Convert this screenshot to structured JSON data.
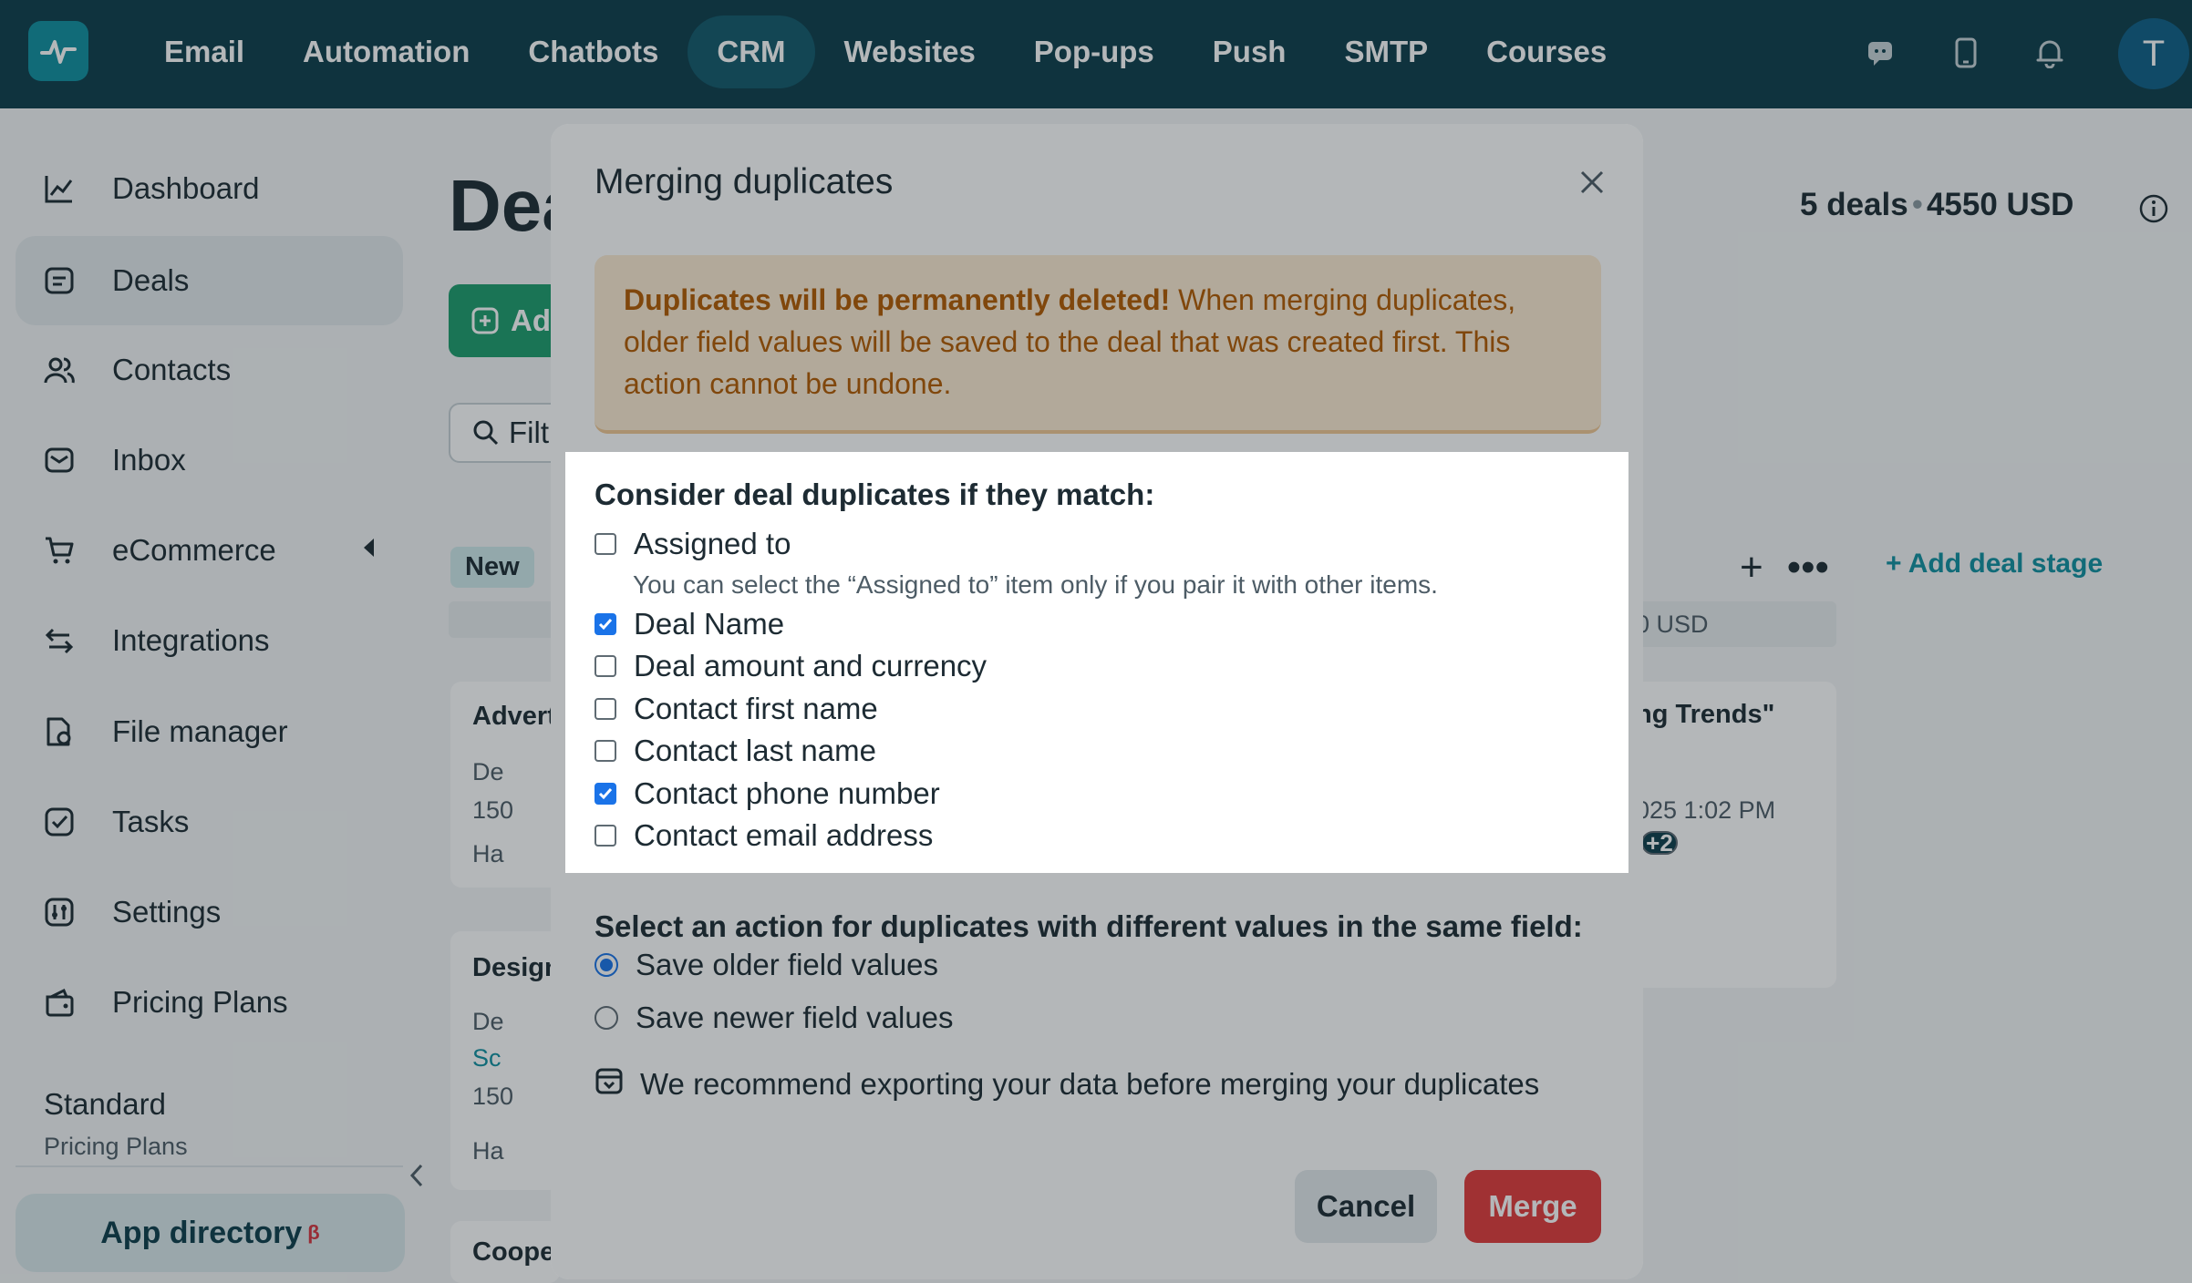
{
  "nav": {
    "items": [
      "Email",
      "Automation",
      "Chatbots",
      "CRM",
      "Websites",
      "Pop-ups",
      "Push",
      "SMTP",
      "Courses"
    ],
    "active": "CRM",
    "avatar_letter": "T",
    "icons": [
      "chat-icon",
      "mobile-icon",
      "bell-icon"
    ]
  },
  "sidebar": {
    "items": [
      {
        "label": "Dashboard",
        "icon": "chart-icon"
      },
      {
        "label": "Deals",
        "icon": "deals-icon"
      },
      {
        "label": "Contacts",
        "icon": "contacts-icon"
      },
      {
        "label": "Inbox",
        "icon": "inbox-icon"
      },
      {
        "label": "eCommerce",
        "icon": "cart-icon"
      },
      {
        "label": "Integrations",
        "icon": "integrations-icon"
      },
      {
        "label": "File manager",
        "icon": "file-icon"
      },
      {
        "label": "Tasks",
        "icon": "tasks-icon"
      },
      {
        "label": "Settings",
        "icon": "settings-icon"
      },
      {
        "label": "Pricing Plans",
        "icon": "wallet-icon"
      }
    ],
    "active": "Deals",
    "plan_name": "Standard",
    "plan_sub": "Pricing Plans",
    "app_directory": "App directory",
    "app_directory_badge": "β"
  },
  "main": {
    "title_partial": "Dea",
    "summary_deals": "5 deals",
    "summary_amount": "4550 USD",
    "add_button_partial": "Ad",
    "filter_partial": "Filt",
    "stage_new": "New",
    "add_stage": "+ Add deal stage",
    "right_col_total": "0 USD",
    "right_card_title": "ng Trends\"",
    "right_card_date": "025 1:02 PM",
    "right_card_badge": "+2",
    "cards": [
      {
        "title": "Advert",
        "line1": "De",
        "line2": "150",
        "line3": "Ha"
      },
      {
        "title": "Design",
        "line1": "De",
        "line2": "Sc",
        "line3": "150",
        "line4": "Ha"
      },
      {
        "title": "Coope"
      }
    ]
  },
  "modal": {
    "title": "Merging duplicates",
    "warning_bold": "Duplicates will be permanently deleted!",
    "warning_text": " When merging duplicates, older field values will be saved to the deal that was created first. This action cannot be undone.",
    "match_heading": "Consider deal duplicates if they match:",
    "options": [
      {
        "label": "Assigned to",
        "checked": false
      },
      {
        "label": "Deal Name",
        "checked": true
      },
      {
        "label": "Deal amount and currency",
        "checked": false
      },
      {
        "label": "Contact first name",
        "checked": false
      },
      {
        "label": "Contact last name",
        "checked": false
      },
      {
        "label": "Contact phone number",
        "checked": true
      },
      {
        "label": "Contact email address",
        "checked": false
      }
    ],
    "assigned_hint": "You can select the “Assigned to” item only if you pair it with other items.",
    "action_heading": "Select an action for duplicates with different values in the same field:",
    "radios": [
      {
        "label": "Save older field values",
        "selected": true
      },
      {
        "label": "Save newer field values",
        "selected": false
      }
    ],
    "export_note": "We recommend exporting your data before merging your duplicates",
    "cancel_label": "Cancel",
    "merge_label": "Merge"
  },
  "colors": {
    "topbar": "#0d3d4b",
    "accent": "#0f8fa0",
    "merge": "#e23a3a",
    "warning_bg": "#fdebd2",
    "warning_text": "#b35a00",
    "checkbox_on": "#1a73e8"
  }
}
